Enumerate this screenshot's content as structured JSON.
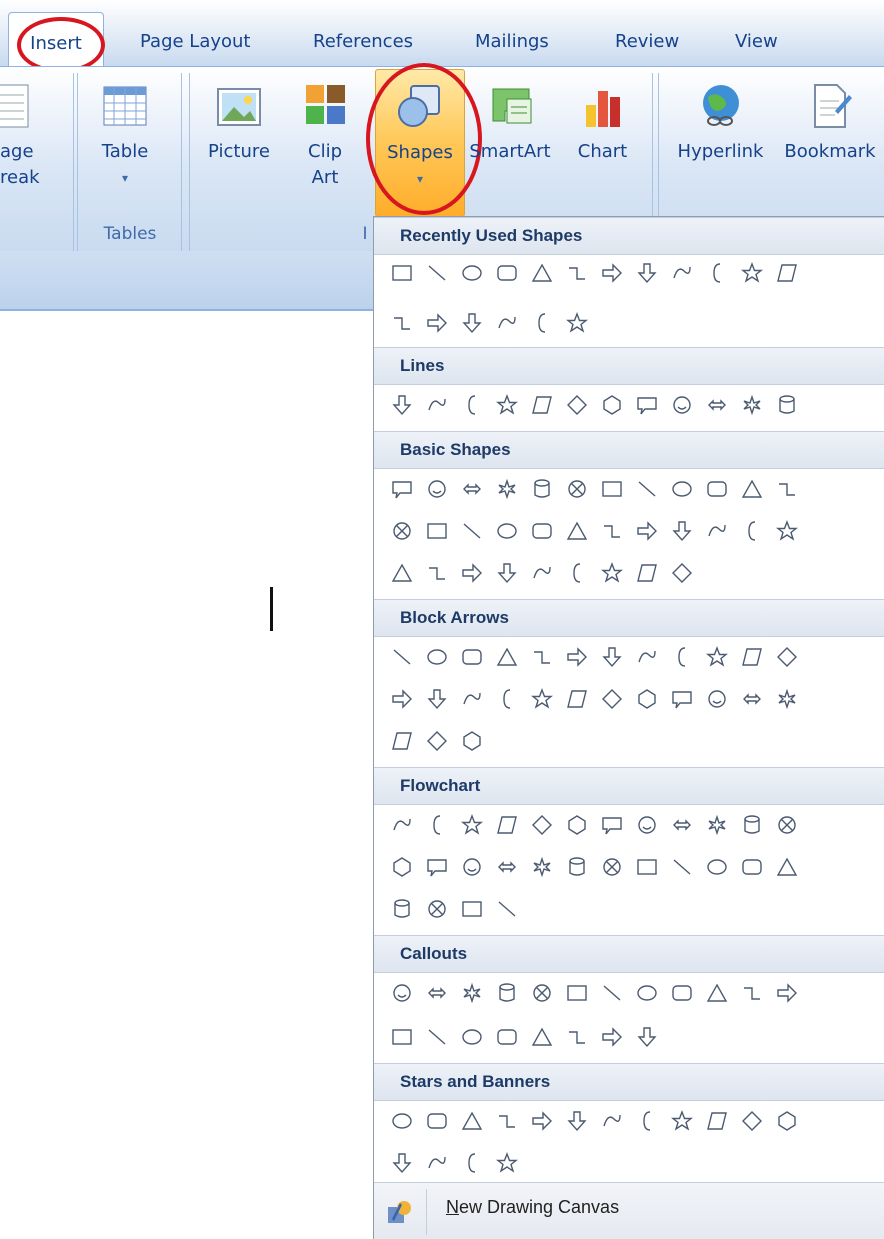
{
  "tabs": {
    "insert": "Insert",
    "page_layout": "Page Layout",
    "references": "References",
    "mailings": "Mailings",
    "review": "Review",
    "view": "View"
  },
  "ribbon": {
    "page_break_line1": "age",
    "page_break_line2": "reak",
    "table": "Table",
    "table_group": "Tables",
    "picture": "Picture",
    "clip_line1": "Clip",
    "clip_line2": "Art",
    "shapes": "Shapes",
    "smartart": "SmartArt",
    "chart": "Chart",
    "illustrations_group_partial": "I",
    "hyperlink": "Hyperlink",
    "bookmark": "Bookmark"
  },
  "dropdown": {
    "sections": [
      {
        "title": "Recently Used Shapes",
        "rows": [
          12,
          6
        ]
      },
      {
        "title": "Lines",
        "rows": [
          12
        ]
      },
      {
        "title": "Basic Shapes",
        "rows": [
          12,
          12,
          9
        ]
      },
      {
        "title": "Block Arrows",
        "rows": [
          12,
          12,
          3
        ]
      },
      {
        "title": "Flowchart",
        "rows": [
          12,
          12,
          4
        ]
      },
      {
        "title": "Callouts",
        "rows": [
          12,
          8
        ]
      },
      {
        "title": "Stars and Banners",
        "rows": [
          12,
          4
        ]
      }
    ],
    "new_canvas_access_key": "N",
    "new_canvas_rest": "ew Drawing Canvas"
  },
  "colors": {
    "ribbon_text": "#15428b",
    "highlight": "#ffc756",
    "annotation": "#d8161f"
  }
}
